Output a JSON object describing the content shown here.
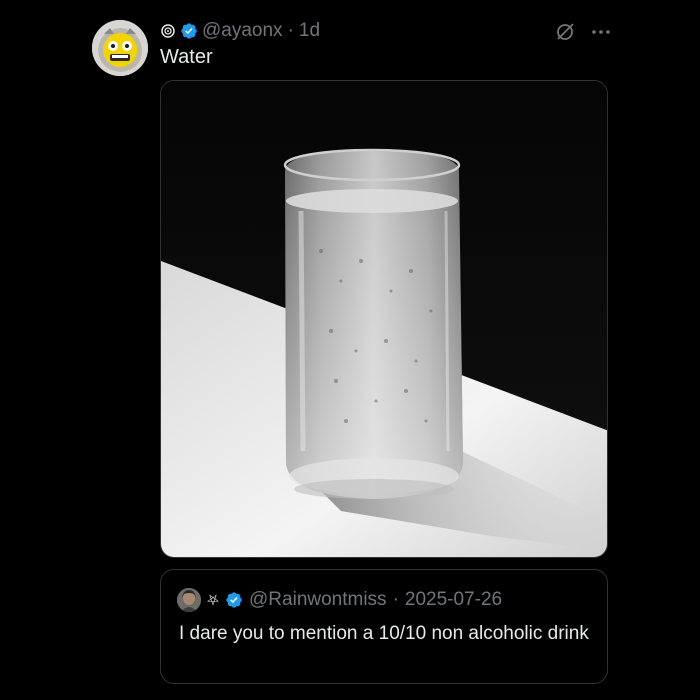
{
  "post": {
    "handle": "@ayaonx",
    "separator": "·",
    "time": "1d",
    "text": "Water",
    "icons": {
      "badge": "verified-badge-icon",
      "prefix": "spiral-icon",
      "grok": "grok-icon",
      "more": "more-icon"
    },
    "more_label": "···",
    "media_alt": "Glass of water"
  },
  "quote": {
    "handle": "@Rainwontmiss",
    "separator": "·",
    "date": "2025-07-26",
    "text": "I dare you to mention a 10/10 non alcoholic drink",
    "prefix_symbol": "⛧"
  },
  "colors": {
    "background": "#000000",
    "text": "#e7e9ea",
    "muted": "#71767b",
    "border": "#2f3336",
    "verified": "#1d9bf0"
  }
}
